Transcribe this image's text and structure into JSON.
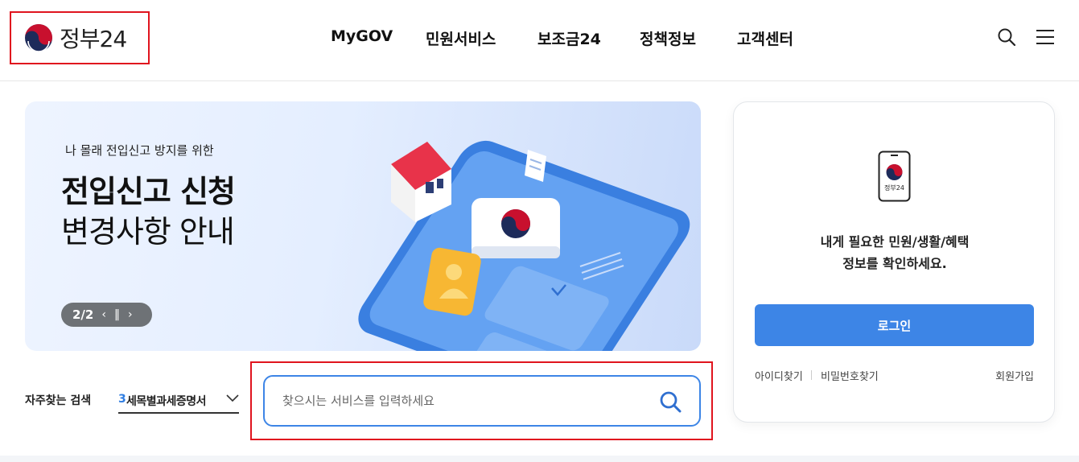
{
  "header": {
    "logo_text": "정부24",
    "nav": [
      "MyGOV",
      "민원서비스",
      "보조금24",
      "정책정보",
      "고객센터"
    ],
    "icons": [
      "search-icon",
      "hamburger-menu-icon"
    ]
  },
  "banner": {
    "subtitle": "나 몰래 전입신고 방지를 위한",
    "title_line1": "전입신고 신청",
    "title_line2": "변경사항 안내",
    "pager": "2/2"
  },
  "login": {
    "phone_label": "정부24",
    "message_line1": "내게 필요한 민원/생활/혜택",
    "message_line2": "정보를 확인하세요.",
    "button": "로그인",
    "find_id": "아이디찾기",
    "find_pw": "비밀번호찾기",
    "join": "회원가입"
  },
  "search": {
    "frequent_label": "자주찾는 검색",
    "frequent_rank": "3",
    "frequent_item": "세목별과세증명서",
    "placeholder": "찾으시는 서비스를 입력하세요"
  },
  "colors": {
    "accent": "#3d85e6",
    "highlight_border": "#e0141e",
    "banner_bg": "#e4eeff",
    "pager_bg": "#6e7276"
  }
}
